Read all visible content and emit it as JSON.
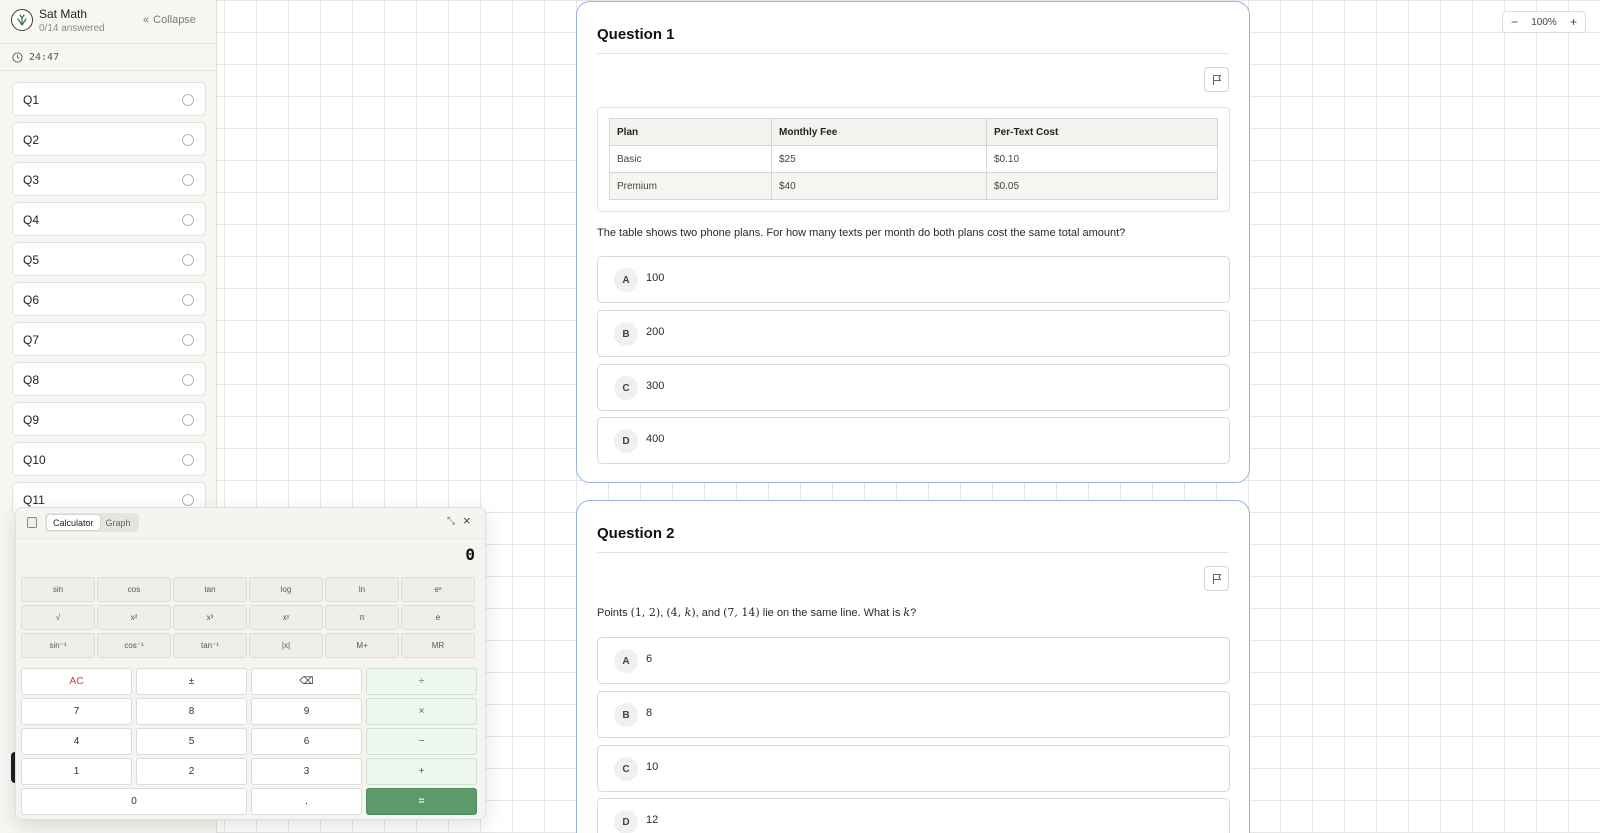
{
  "app": {
    "title": "Sat Math",
    "subtitle": "0/14 answered",
    "collapse_label": "Collapse",
    "timer": "24:47"
  },
  "sidebar": {
    "items": [
      {
        "label": "Q1"
      },
      {
        "label": "Q2"
      },
      {
        "label": "Q3"
      },
      {
        "label": "Q4"
      },
      {
        "label": "Q5"
      },
      {
        "label": "Q6"
      },
      {
        "label": "Q7"
      },
      {
        "label": "Q8"
      },
      {
        "label": "Q9"
      },
      {
        "label": "Q10"
      },
      {
        "label": "Q11"
      }
    ]
  },
  "calculator": {
    "tabs": [
      "Calculator",
      "Graph"
    ],
    "active_tab": "Calculator",
    "display": "0",
    "sci_buttons": [
      "sin",
      "cos",
      "tan",
      "log",
      "ln",
      "eˣ",
      "√",
      "x²",
      "x³",
      "xʸ",
      "π",
      "e",
      "sin⁻¹",
      "cos⁻¹",
      "tan⁻¹",
      "|x|",
      "M+",
      "MR"
    ],
    "num_buttons": [
      "AC",
      "±",
      "⌫",
      "÷",
      "7",
      "8",
      "9",
      "×",
      "4",
      "5",
      "6",
      "−",
      "1",
      "2",
      "3",
      "+",
      "0",
      ".",
      "="
    ]
  },
  "zoom": {
    "level": "100%",
    "minus": "−",
    "plus": "+"
  },
  "questions": [
    {
      "title": "Question 1",
      "table": {
        "headers": [
          "Plan",
          "Monthly Fee",
          "Per-Text Cost"
        ],
        "rows": [
          [
            "Basic",
            "$25",
            "$0.10"
          ],
          [
            "Premium",
            "$40",
            "$0.05"
          ]
        ]
      },
      "prompt": "The table shows two phone plans. For how many texts per month do both plans cost the same total amount?",
      "choices": [
        {
          "letter": "A",
          "text": "100"
        },
        {
          "letter": "B",
          "text": "200"
        },
        {
          "letter": "C",
          "text": "300"
        },
        {
          "letter": "D",
          "text": "400"
        }
      ]
    },
    {
      "title": "Question 2",
      "prompt_parts": {
        "p1": "Points ",
        "pt1": "(1, 2)",
        "sep1": ", ",
        "pt2a": "(4, ",
        "pt2k": "k",
        "pt2b": ")",
        "sep2": ", and ",
        "pt3": "(7, 14)",
        "p2": " lie on the same line. What is ",
        "k": "k",
        "p3": "?"
      },
      "choices": [
        {
          "letter": "A",
          "text": "6"
        },
        {
          "letter": "B",
          "text": "8"
        },
        {
          "letter": "C",
          "text": "10"
        },
        {
          "letter": "D",
          "text": "12"
        }
      ]
    }
  ],
  "colors": {
    "accent_border": "#9ab0ea",
    "equals_button": "#5c9a6b",
    "clear_text": "#d33a3a"
  }
}
